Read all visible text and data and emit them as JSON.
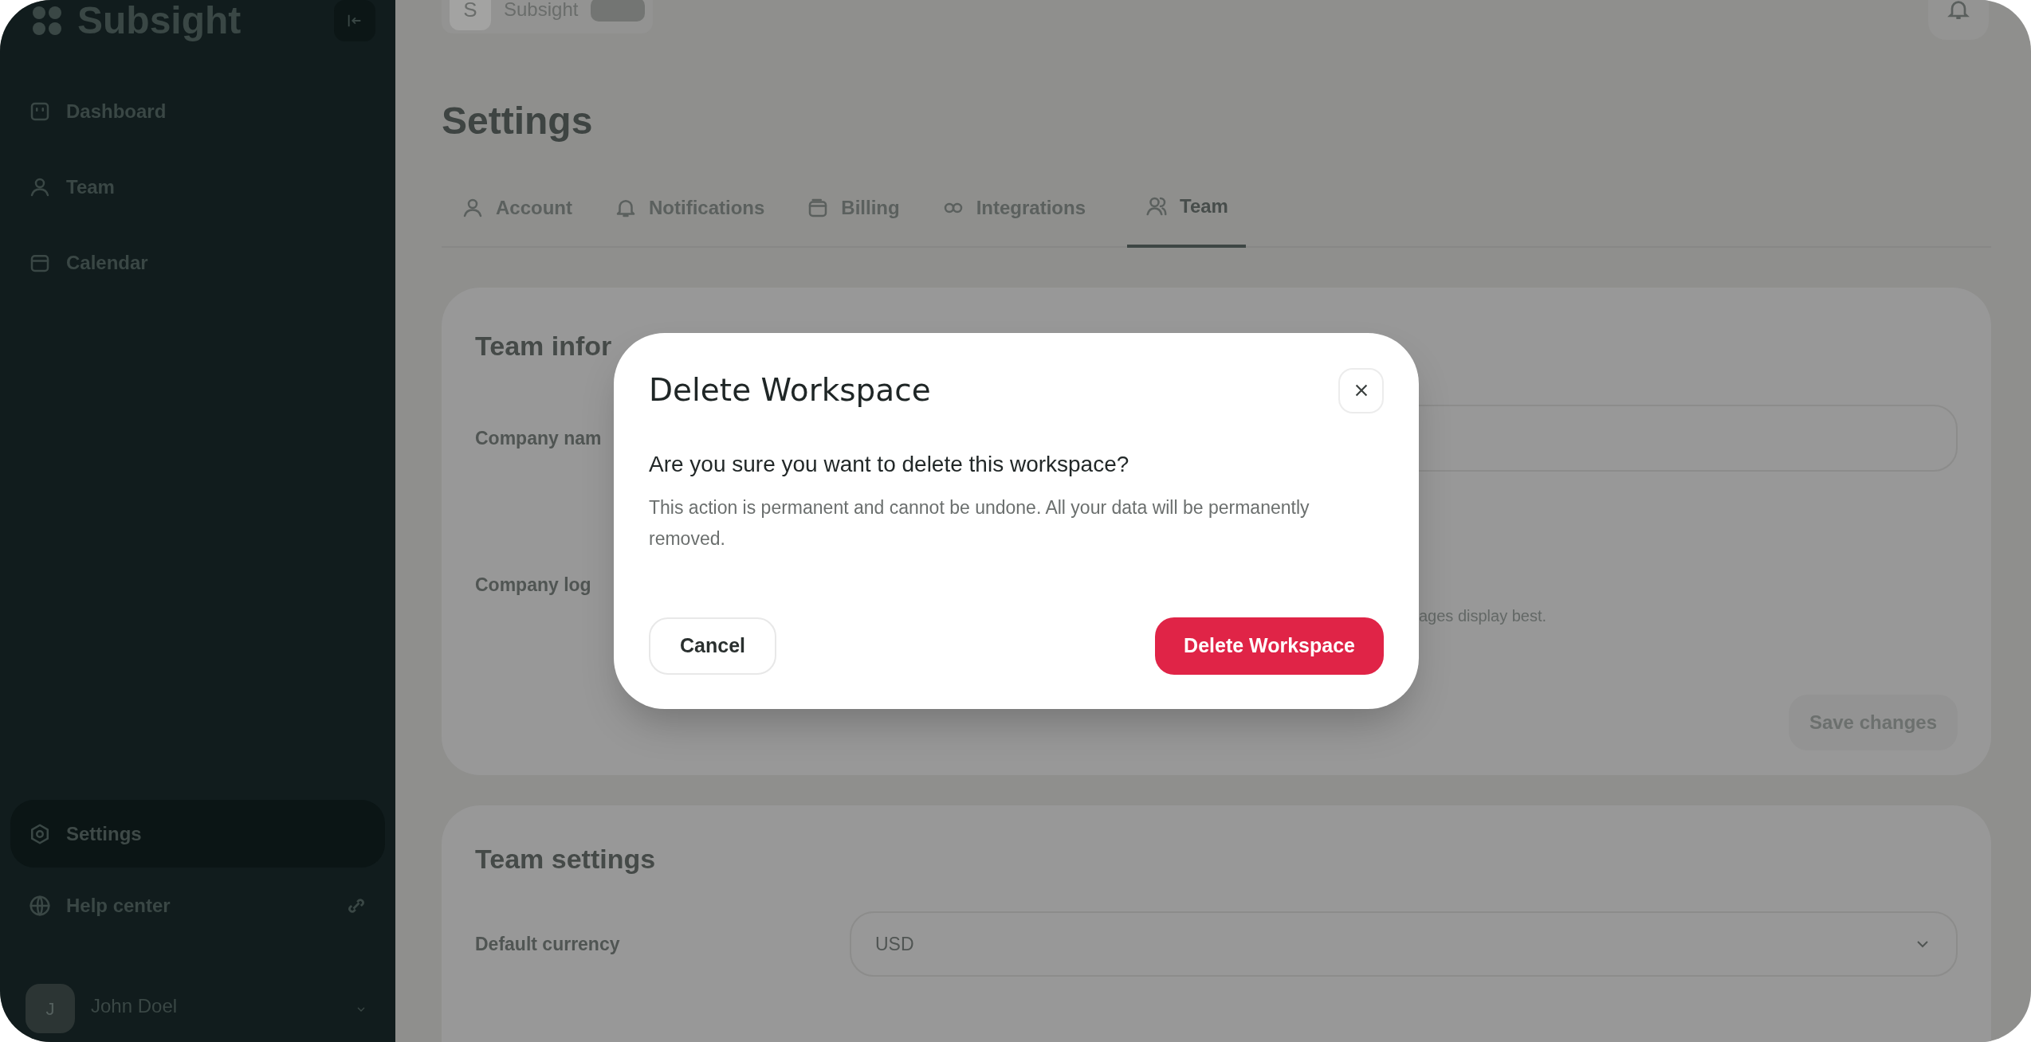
{
  "sidebar": {
    "brand": "Subsight",
    "items": [
      {
        "label": "Dashboard",
        "selected": false
      },
      {
        "label": "Team",
        "selected": false
      },
      {
        "label": "Calendar",
        "selected": false
      }
    ],
    "footer_items": [
      {
        "label": "Settings",
        "selected": true
      },
      {
        "label": "Help center",
        "selected": false
      }
    ],
    "user": {
      "initial": "J",
      "name": "John Doel"
    }
  },
  "topbar": {
    "workspace_initial": "S",
    "workspace": "Subsight"
  },
  "page": {
    "title": "Settings",
    "tabs": [
      {
        "label": "Account",
        "selected": false
      },
      {
        "label": "Notifications",
        "selected": false
      },
      {
        "label": "Billing",
        "selected": false
      },
      {
        "label": "Integrations",
        "selected": false
      },
      {
        "label": "Team",
        "selected": true
      }
    ]
  },
  "team_information": {
    "title": "Team infor",
    "company_name_label": "Company nam",
    "company_logo_label": "Company log",
    "logo_hint": "ages display best.",
    "save_button": "Save changes"
  },
  "team_settings": {
    "title": "Team settings",
    "currency_label": "Default currency",
    "currency_value": "USD"
  },
  "dialog": {
    "title": "Delete Workspace",
    "question": "Are you sure you want to delete this workspace?",
    "message": "This action is permanent and cannot be undone. All your data will be permanently removed.",
    "cancel": "Cancel",
    "confirm": "Delete Workspace"
  }
}
